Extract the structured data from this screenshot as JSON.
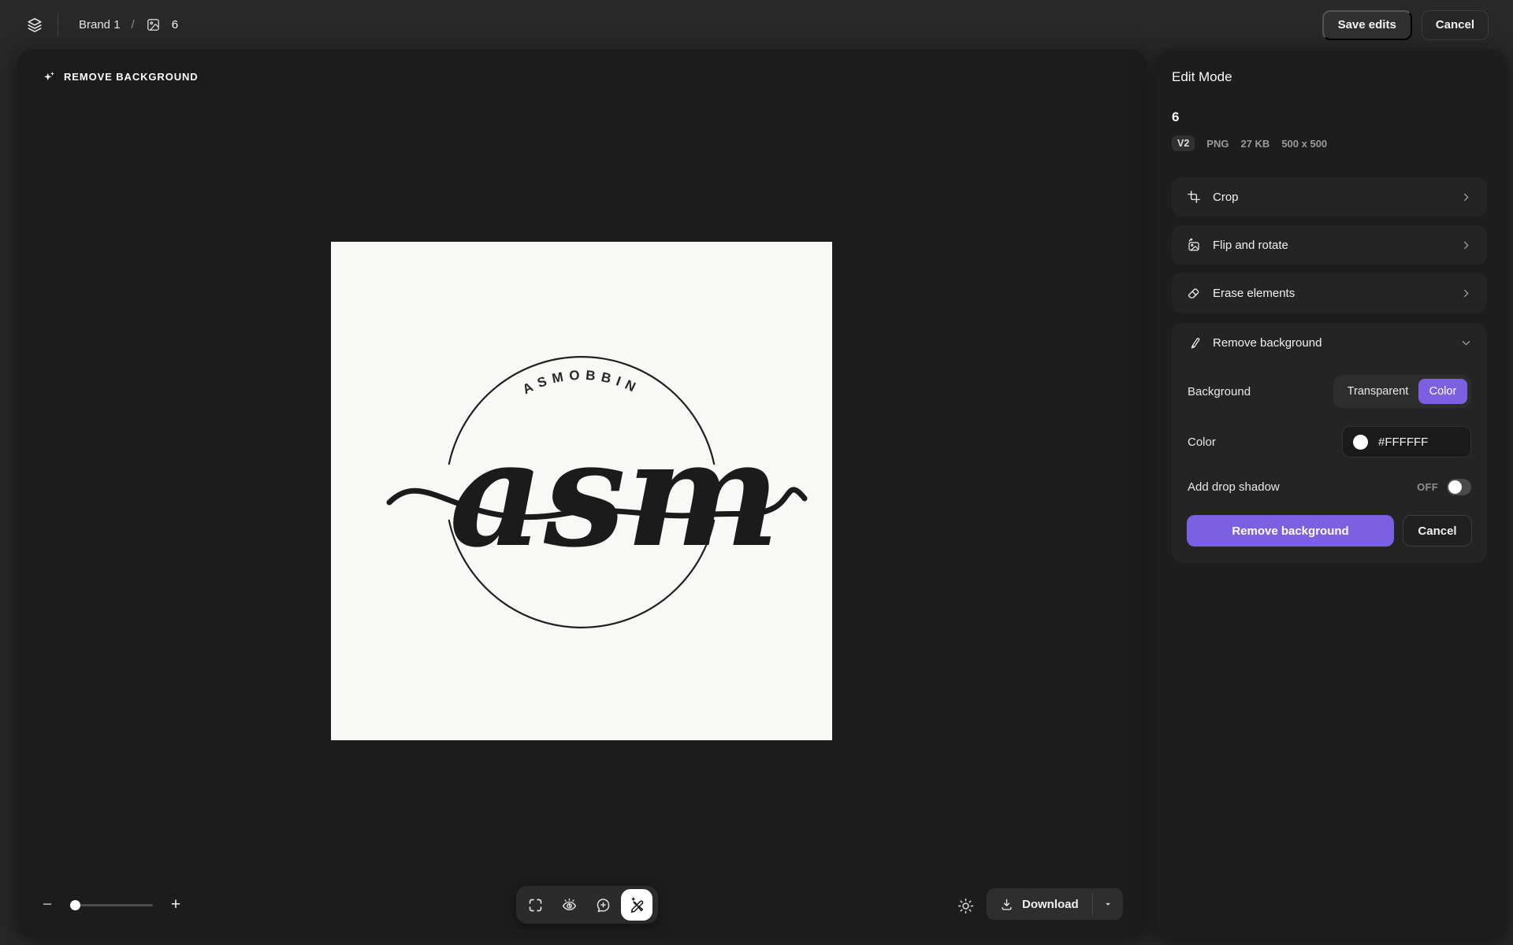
{
  "topbar": {
    "breadcrumb": {
      "brand": "Brand 1",
      "separator": "/",
      "asset": "6"
    },
    "save_button": "Save edits",
    "cancel_button": "Cancel"
  },
  "canvas": {
    "mode_label": "REMOVE BACKGROUND",
    "logo": {
      "arc_text": "ASMOBBIN",
      "script_text": "asm",
      "bg_hex": "#F8F8F6",
      "ink_hex": "#1C1C1C"
    }
  },
  "footer": {
    "zoom_out": "−",
    "zoom_in": "+",
    "download_label": "Download"
  },
  "panel": {
    "title": "Edit Mode",
    "asset": {
      "name": "6",
      "version": "V2",
      "format": "PNG",
      "filesize": "27 KB",
      "dimensions": "500 x 500"
    },
    "tools": [
      {
        "label": "Crop"
      },
      {
        "label": "Flip and rotate"
      },
      {
        "label": "Erase elements"
      }
    ],
    "remove_background": {
      "title": "Remove background",
      "background_label": "Background",
      "option_transparent": "Transparent",
      "option_color": "Color",
      "color_label": "Color",
      "color_value": "#FFFFFF",
      "shadow_label": "Add drop shadow",
      "shadow_state": "OFF",
      "apply_button": "Remove background",
      "cancel_button": "Cancel"
    },
    "accent_hex": "#7B61E2"
  }
}
